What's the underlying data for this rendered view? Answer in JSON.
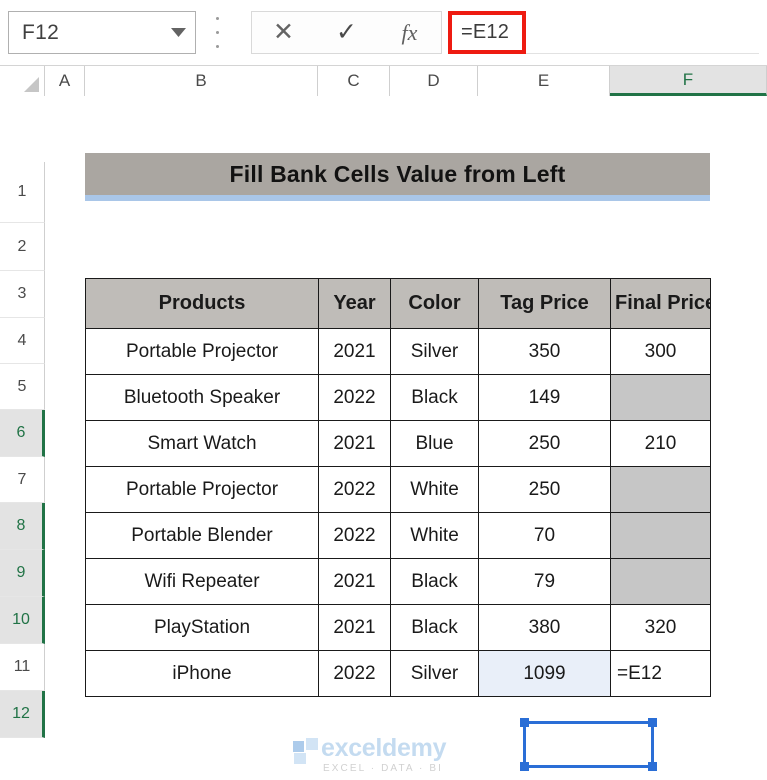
{
  "formula_bar": {
    "name_box_value": "F12",
    "name_box_icon": "chevron-down-icon",
    "kebab_icon": "more-options-icon",
    "cancel_label": "✕",
    "enter_label": "✓",
    "fx_label": "fx",
    "formula_value": "=E12",
    "highlight_color": "#ee1b11"
  },
  "grid": {
    "columns": [
      {
        "label": "A",
        "selected": false
      },
      {
        "label": "B",
        "selected": false
      },
      {
        "label": "C",
        "selected": false
      },
      {
        "label": "D",
        "selected": false
      },
      {
        "label": "E",
        "selected": false
      },
      {
        "label": "F",
        "selected": true
      }
    ],
    "rows": [
      {
        "label": "1",
        "selected": false
      },
      {
        "label": "2",
        "selected": false
      },
      {
        "label": "3",
        "selected": false
      },
      {
        "label": "4",
        "selected": false
      },
      {
        "label": "5",
        "selected": false
      },
      {
        "label": "6",
        "selected": true
      },
      {
        "label": "7",
        "selected": false
      },
      {
        "label": "8",
        "selected": true
      },
      {
        "label": "9",
        "selected": true
      },
      {
        "label": "10",
        "selected": true
      },
      {
        "label": "11",
        "selected": false
      },
      {
        "label": "12",
        "selected": true
      }
    ],
    "selection_accent": "#217346"
  },
  "title_banner": {
    "text": "Fill Bank Cells Value from Left",
    "fill": "#aaa6a1",
    "underline": "#a9c6e8"
  },
  "table": {
    "headers": [
      "Products",
      "Year",
      "Color",
      "Tag Price",
      "Final Price"
    ],
    "rows": [
      {
        "products": "Portable Projector",
        "year": "2021",
        "color": "Silver",
        "tag_price": "350",
        "final_price": "300",
        "final_blank": false
      },
      {
        "products": "Bluetooth Speaker",
        "year": "2022",
        "color": "Black",
        "tag_price": "149",
        "final_price": "",
        "final_blank": true
      },
      {
        "products": "Smart Watch",
        "year": "2021",
        "color": "Blue",
        "tag_price": "250",
        "final_price": "210",
        "final_blank": false
      },
      {
        "products": "Portable Projector",
        "year": "2022",
        "color": "White",
        "tag_price": "250",
        "final_price": "",
        "final_blank": true
      },
      {
        "products": "Portable Blender",
        "year": "2022",
        "color": "White",
        "tag_price": "70",
        "final_price": "",
        "final_blank": true
      },
      {
        "products": "Wifi Repeater",
        "year": "2021",
        "color": "Black",
        "tag_price": "79",
        "final_price": "",
        "final_blank": true
      },
      {
        "products": "PlayStation",
        "year": "2021",
        "color": "Black",
        "tag_price": "380",
        "final_price": "320",
        "final_blank": false
      },
      {
        "products": "iPhone",
        "year": "2022",
        "color": "Silver",
        "tag_price": "1099",
        "final_price": "=E12",
        "final_blank": false
      }
    ],
    "header_fill": "#bfbcb8",
    "blank_fill": "#c6c6c6"
  },
  "marquee": {
    "target_cell": "E12",
    "color": "#2a6ed6"
  },
  "watermark": {
    "name": "exceldemy",
    "tagline": "EXCEL · DATA · BI"
  }
}
